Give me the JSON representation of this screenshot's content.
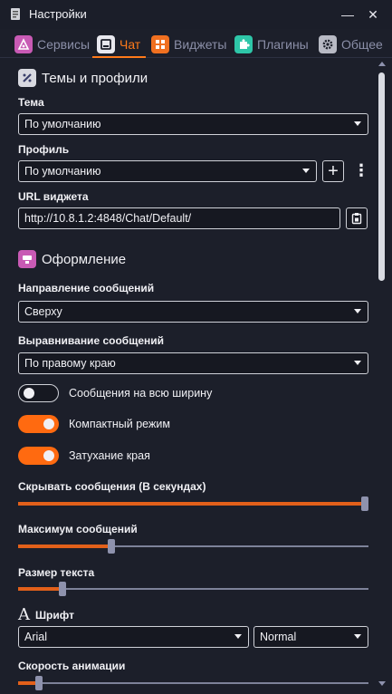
{
  "window": {
    "title": "Настройки",
    "minimize_glyph": "—",
    "close_glyph": "✕"
  },
  "tabs": [
    {
      "label": "Сервисы",
      "icon": "services-icon",
      "color": "#c85ab4",
      "active": false
    },
    {
      "label": "Чат",
      "icon": "chat-icon",
      "color": "#e8e8ee",
      "active": true
    },
    {
      "label": "Виджеты",
      "icon": "widgets-icon",
      "color": "#f07020",
      "active": false
    },
    {
      "label": "Плагины",
      "icon": "plugins-icon",
      "color": "#2ec6a8",
      "active": false
    },
    {
      "label": "Общее",
      "icon": "gear-icon",
      "color": "#b8bac4",
      "active": false
    }
  ],
  "colors": {
    "accent": "#ff7a1a",
    "background": "#1c1f2a",
    "toggle_on": "#ff6a10"
  },
  "themes_section": {
    "title": "Темы и профили",
    "theme_label": "Тема",
    "theme_value": "По умолчанию",
    "profile_label": "Профиль",
    "profile_value": "По умолчанию",
    "add_glyph": "+",
    "more_glyph": "⋮",
    "url_label": "URL виджета",
    "url_value": "http://10.8.1.2:4848/Chat/Default/"
  },
  "appearance_section": {
    "title": "Оформление",
    "direction_label": "Направление сообщений",
    "direction_value": "Сверху",
    "alignment_label": "Выравнивание сообщений",
    "alignment_value": "По правому краю",
    "toggles": [
      {
        "label": "Сообщения на всю ширину",
        "on": false
      },
      {
        "label": "Компактный режим",
        "on": true
      },
      {
        "label": "Затухание края",
        "on": true
      }
    ],
    "hide_label": "Скрывать сообщения (В секундах)",
    "hide_value": 1.0,
    "max_label": "Максимум сообщений",
    "max_value": 0.26,
    "text_size_label": "Размер текста",
    "text_size_value": 0.12,
    "font_glyph": "A",
    "font_label": "Шрифт",
    "font_value": "Arial",
    "font_weight_value": "Normal",
    "anim_label": "Скорость анимации",
    "anim_value": 0.05
  }
}
